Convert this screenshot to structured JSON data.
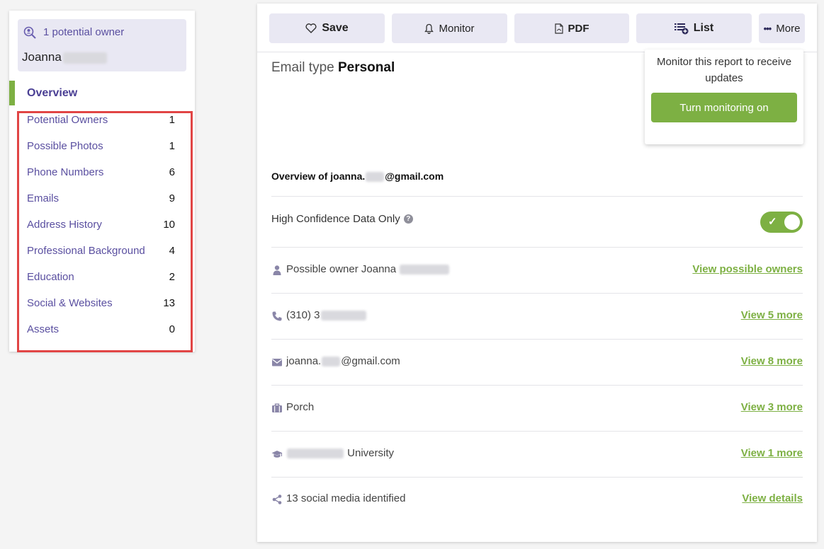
{
  "sidebar": {
    "owner_count": "1 potential owner",
    "owner_name": "Joanna",
    "overview_label": "Overview",
    "items": [
      {
        "label": "Potential Owners",
        "count": "1"
      },
      {
        "label": "Possible Photos",
        "count": "1"
      },
      {
        "label": "Phone Numbers",
        "count": "6"
      },
      {
        "label": "Emails",
        "count": "9"
      },
      {
        "label": "Address History",
        "count": "10"
      },
      {
        "label": "Professional Background",
        "count": "4"
      },
      {
        "label": "Education",
        "count": "2"
      },
      {
        "label": "Social & Websites",
        "count": "13"
      },
      {
        "label": "Assets",
        "count": "0"
      }
    ]
  },
  "toolbar": {
    "save": "Save",
    "monitor": "Monitor",
    "pdf": "PDF",
    "list": "List",
    "more": "More"
  },
  "report": {
    "email_type_label": "Email type",
    "email_type_value": "Personal",
    "overview_prefix": "Overview of joanna.",
    "overview_suffix": "@gmail.com",
    "confidence_label": "High Confidence Data Only",
    "toggle_on": true
  },
  "monitor_popup": {
    "text": "Monitor this report to receive updates",
    "button": "Turn monitoring on"
  },
  "rows": [
    {
      "icon": "user-icon",
      "text": "Possible owner Joanna",
      "link": "View possible owners"
    },
    {
      "icon": "phone-icon",
      "text": "(310) 3",
      "link": "View 5 more"
    },
    {
      "icon": "envelope-icon",
      "text_prefix": "joanna.",
      "text_suffix": "@gmail.com",
      "link": "View 8 more"
    },
    {
      "icon": "briefcase-icon",
      "text": "Porch",
      "link": "View 3 more"
    },
    {
      "icon": "graduation-cap-icon",
      "text": "University",
      "link": "View 1 more"
    },
    {
      "icon": "share-icon",
      "text": "13 social media identified",
      "link": "View details"
    }
  ],
  "colors": {
    "accent_green": "#7db043",
    "nav_purple": "#5a4fa0",
    "button_bg": "#e9e8f3",
    "highlight_red": "#e14545"
  }
}
